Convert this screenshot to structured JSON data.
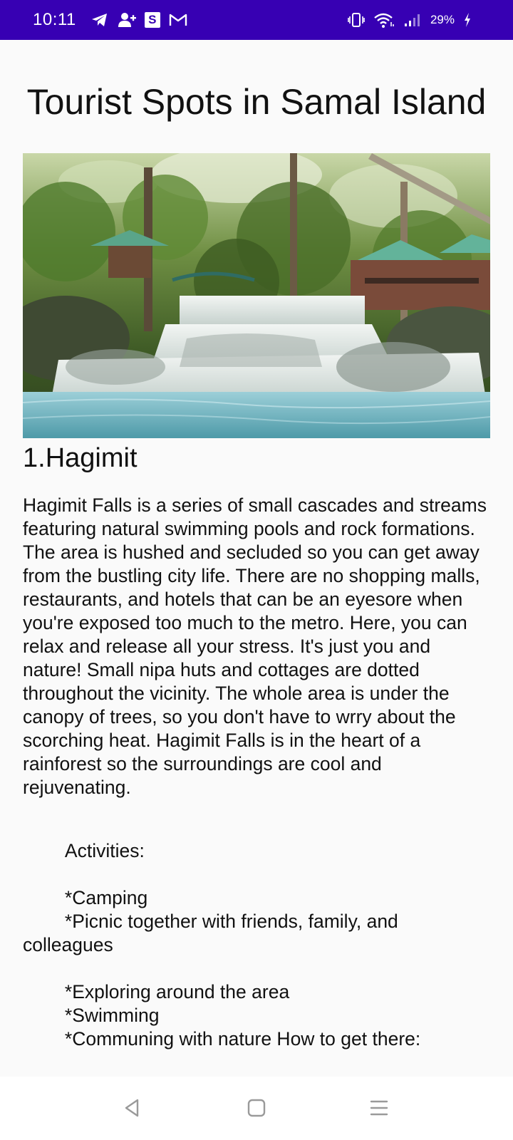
{
  "status_bar": {
    "time": "10:11",
    "battery": "29%",
    "notification_icons": [
      "telegram-icon",
      "contact-add-icon",
      "s-badge-icon",
      "gmail-icon"
    ],
    "s_badge_label": "S",
    "system_icons": [
      "vibrate-icon",
      "wifi-icon",
      "signal-icon",
      "battery-charging-icon"
    ],
    "background_color": "#3700b3"
  },
  "page": {
    "title": "Tourist Spots in Samal Island",
    "spot_heading": "1.Hagimit",
    "description": "Hagimit Falls is a series of small cascades and streams featuring natural swimming pools and rock formations. The area is hushed and secluded so you can get away from the bustling city life. There are no shopping malls, restaurants, and hotels that can be an eyesore when you're exposed too much to the metro. Here, you can relax and release all your stress. It's just you and nature! Small nipa huts and cottages are dotted throughout the vicinity. The whole area is under the canopy of trees, so you don't have to wrry about the scorching heat. Hagimit Falls is in the heart of a rainforest so the surroundings are cool and rejuvenating.",
    "activities": "        Activities:\n\n        *Camping\n        *Picnic together with friends, family, and colleagues\n\n        *Exploring around the area\n        *Swimming\n        *Communing with nature How to get there:"
  },
  "nav_bar": {
    "buttons": [
      "back-icon",
      "home-icon",
      "recents-icon"
    ]
  }
}
